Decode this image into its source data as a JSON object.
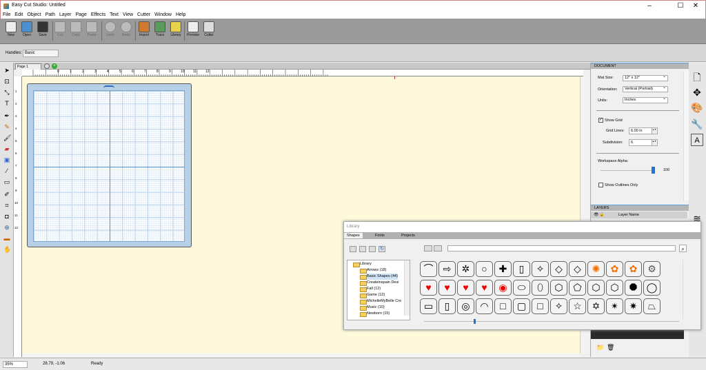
{
  "window": {
    "title": "Easy Cut Studio: Untitled",
    "min": "–",
    "max": "☐",
    "close": "✕"
  },
  "menu": [
    "File",
    "Edit",
    "Object",
    "Path",
    "Layer",
    "Page",
    "Effects",
    "Text",
    "View",
    "Cutter",
    "Window",
    "Help"
  ],
  "toolbar": {
    "new": "New",
    "open": "Open",
    "save": "Save",
    "cut": "Cut",
    "copy": "Copy",
    "paste": "Paste",
    "undo": "Undo",
    "redo": "Redo",
    "import": "Import",
    "trace": "Trace",
    "library": "Library",
    "preview": "Preview",
    "cutter": "Cutter"
  },
  "handles": {
    "label": "Handles:",
    "value": "Basic"
  },
  "page_tab": "Page 1",
  "ruler_top": [
    "0",
    "1",
    "2",
    "3",
    "4",
    "5",
    "6",
    "7",
    "8",
    "9",
    "10",
    "11",
    "12"
  ],
  "ruler_left": [
    "1",
    "2",
    "3",
    "4",
    "5",
    "6",
    "7",
    "8",
    "9",
    "10",
    "11",
    "12"
  ],
  "document": {
    "heading": "DOCUMENT",
    "mat_size_label": "Mat Size:",
    "mat_size": "12\" x 12\"",
    "orientation_label": "Orientation:",
    "orientation": "Vertical (Portrait)",
    "units_label": "Units:",
    "units": "Inches",
    "show_grid": "Show Grid",
    "grid_lines_label": "Grid Lines:",
    "grid_lines": "6.00 in",
    "subdivision_label": "Subdivision:",
    "subdivision": "6",
    "alpha_label": "Workspace Alpha:",
    "alpha": "100",
    "show_outlines": "Show Outlines Only"
  },
  "layers": {
    "heading": "LAYERS",
    "col_name": "Layer Name"
  },
  "library": {
    "title": "Library",
    "tabs": [
      "Shapes",
      "Fonts",
      "Projects"
    ],
    "tree": [
      "Library",
      "Arrows (18)",
      "Basic Shapes (44)",
      "Createinspain Desi",
      "Fall (12)",
      "Game (12)",
      "MichelleMyBelle Cre",
      "Music (10)",
      "Newborn (15)"
    ]
  },
  "status": {
    "zoom": "35%",
    "coords": "28.79, -1.06",
    "state": "Ready"
  }
}
